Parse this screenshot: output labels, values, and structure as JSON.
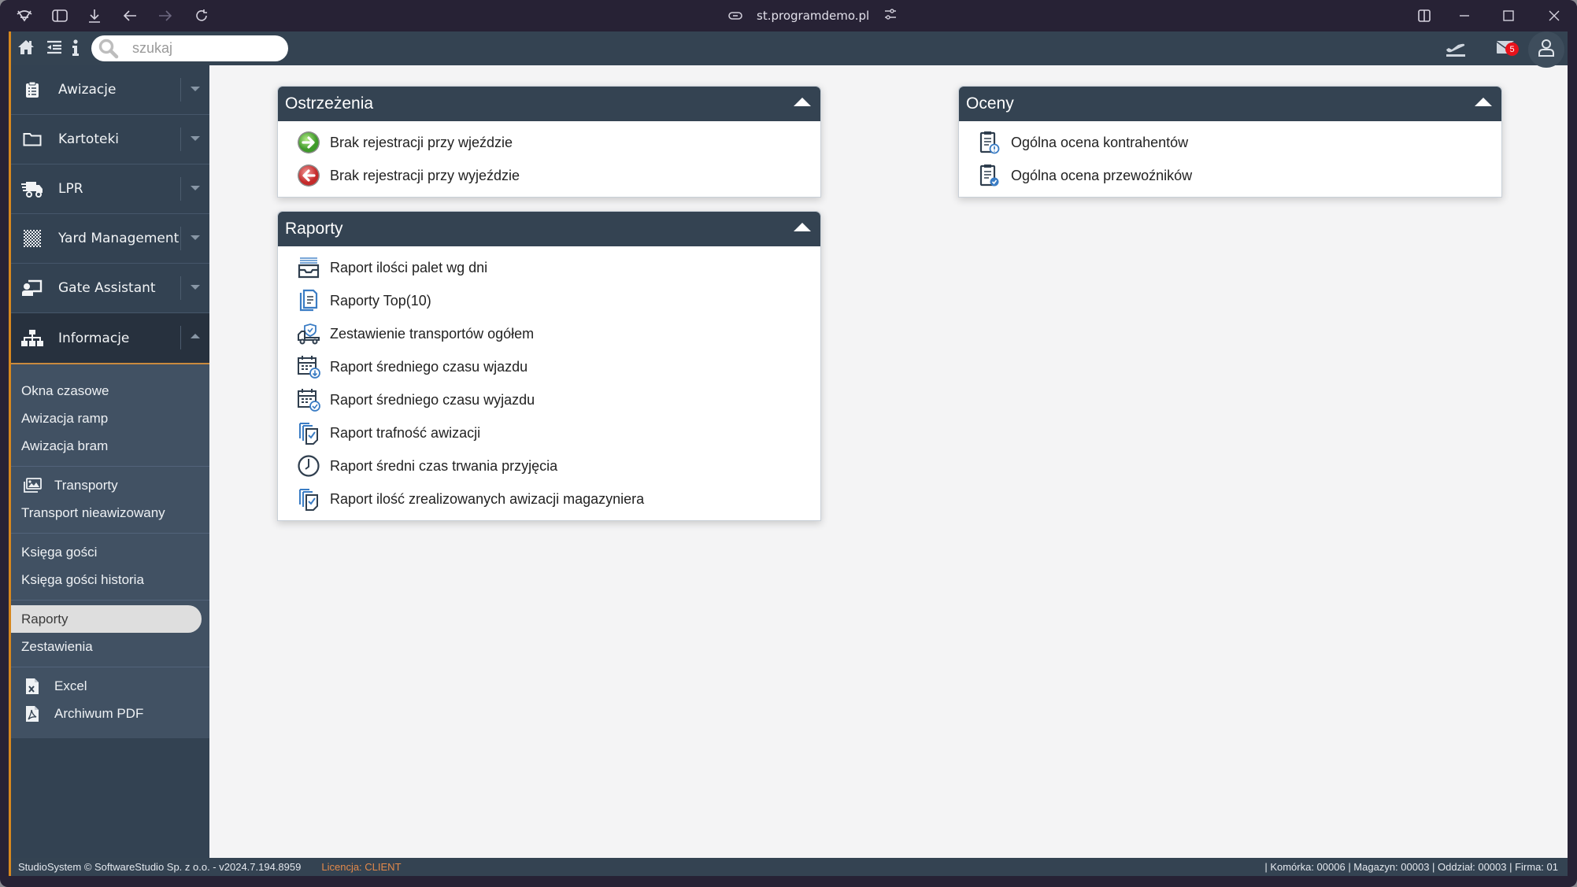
{
  "browser": {
    "url": "st.programdemo.pl",
    "icons": [
      "app-logo-icon",
      "sidebar-toggle-icon",
      "download-icon",
      "back-icon",
      "forward-icon",
      "reload-icon",
      "link-icon",
      "site-settings-icon",
      "split-view-icon",
      "minimize-icon",
      "maximize-icon",
      "close-icon"
    ]
  },
  "topbar": {
    "search_placeholder": "szukaj",
    "search_value": "",
    "mail_count": "5",
    "icons": [
      "home-icon",
      "collapse-menu-icon",
      "info-icon",
      "departures-icon",
      "mail-icon",
      "user-icon"
    ]
  },
  "sidebar": {
    "menu": [
      {
        "label": "Awizacje",
        "icon": "clipboard-icon",
        "open": false
      },
      {
        "label": "Kartoteki",
        "icon": "folder-icon",
        "open": false
      },
      {
        "label": "LPR",
        "icon": "truck-icon",
        "open": false
      },
      {
        "label": "Yard Management",
        "icon": "checkerboard-icon",
        "open": false
      },
      {
        "label": "Gate Assistant",
        "icon": "presentation-icon",
        "open": false
      },
      {
        "label": "Informacje",
        "icon": "sitemap-icon",
        "open": true
      }
    ],
    "submenu_groups": [
      {
        "items": [
          {
            "label": "Okna czasowe"
          },
          {
            "label": "Awizacja ramp"
          },
          {
            "label": "Awizacja bram"
          }
        ]
      },
      {
        "items": [
          {
            "label": "Transporty",
            "icon": "images-icon"
          },
          {
            "label": "Transport nieawizowany"
          }
        ]
      },
      {
        "items": [
          {
            "label": "Księga gości"
          },
          {
            "label": "Księga gości historia"
          }
        ]
      },
      {
        "items": [
          {
            "label": "Raporty",
            "active": true
          },
          {
            "label": "Zestawienia"
          }
        ]
      },
      {
        "items": [
          {
            "label": "Excel",
            "icon": "excel-file-icon"
          },
          {
            "label": "Archiwum PDF",
            "icon": "pdf-file-icon"
          }
        ]
      }
    ]
  },
  "panels": {
    "warnings": {
      "title": "Ostrzeżenia",
      "items": [
        {
          "label": "Brak rejestracji przy wjeździe",
          "icon": "green-arrow-right-icon"
        },
        {
          "label": "Brak rejestracji przy wyjeździe",
          "icon": "red-arrow-left-icon"
        }
      ]
    },
    "reports": {
      "title": "Raporty",
      "items": [
        {
          "label": "Raport ilości palet wg dni",
          "icon": "inbox-tray-icon"
        },
        {
          "label": "Raporty Top(10)",
          "icon": "documents-icon"
        },
        {
          "label": "Zestawienie transportów ogółem",
          "icon": "truck-shield-icon"
        },
        {
          "label": "Raport średniego czasu wjazdu",
          "icon": "calendar-down-icon"
        },
        {
          "label": "Raport średniego czasu wyjazdu",
          "icon": "calendar-check-icon"
        },
        {
          "label": "Raport trafność awizacji",
          "icon": "copy-check-icon"
        },
        {
          "label": "Raport średni czas trwania przyjęcia",
          "icon": "clock-icon"
        },
        {
          "label": "Raport ilość zrealizowanych awizacji magazyniera",
          "icon": "copy-check-icon"
        }
      ]
    },
    "ratings": {
      "title": "Oceny",
      "items": [
        {
          "label": "Ogólna ocena kontrahentów",
          "icon": "clipboard-alert-icon"
        },
        {
          "label": "Ogólna ocena przewoźników",
          "icon": "clipboard-check-icon"
        }
      ]
    }
  },
  "footer": {
    "copyright": "StudioSystem © SoftwareStudio Sp. z o.o. - v2024.7.194.8959",
    "license": "Licencja: CLIENT",
    "context": "| Komórka: 00006 | Magazyn: 00003 | Oddział: 00003 | Firma: 01"
  },
  "colors": {
    "accent": "#d6871e",
    "header": "#344352",
    "submenu": "#415163",
    "badge": "#e8121b"
  }
}
